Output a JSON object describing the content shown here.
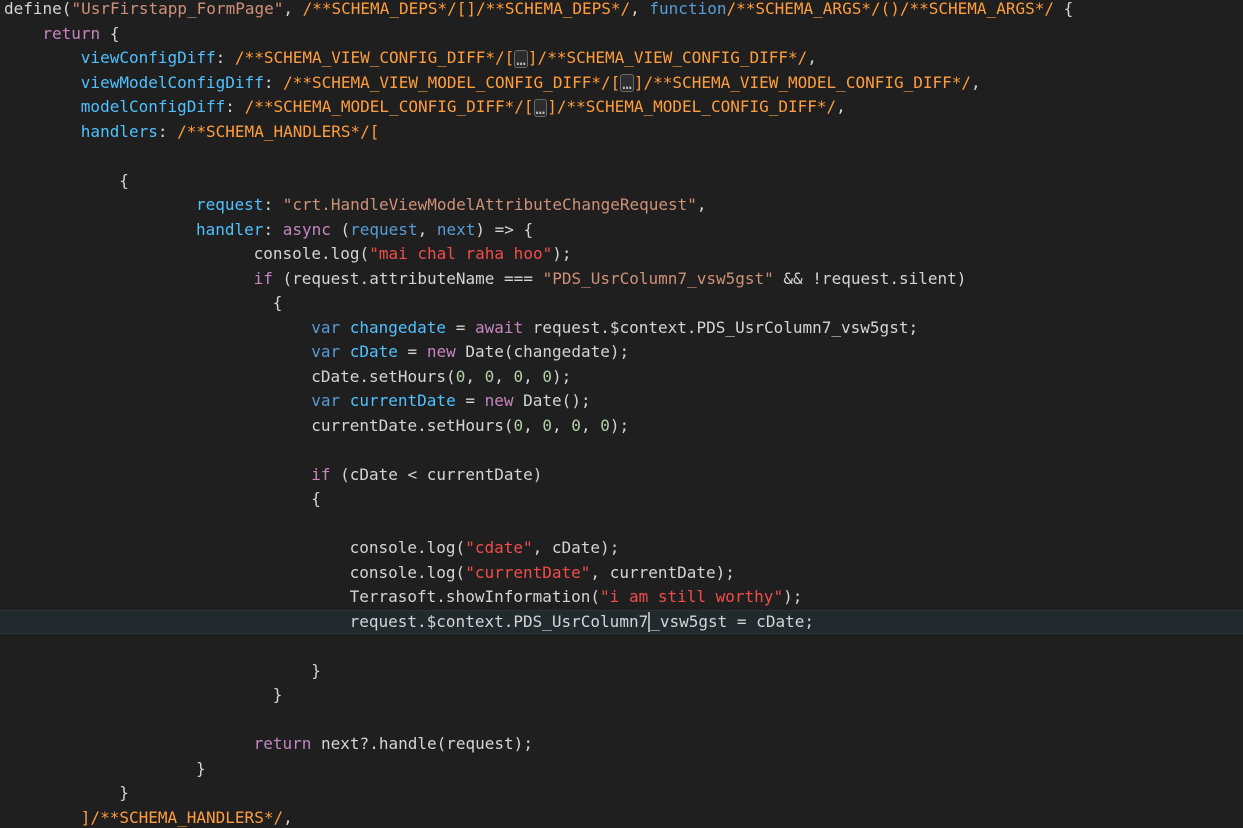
{
  "editor": {
    "lines": [
      {
        "indent": 0,
        "tokens": [
          {
            "t": "define(",
            "k": "plain"
          },
          {
            "t": "\"UsrFirstapp_FormPage\"",
            "k": "str"
          },
          {
            "t": ", ",
            "k": "plain"
          },
          {
            "t": "/**SCHEMA_DEPS*/[]/**SCHEMA_DEPS*/",
            "k": "cmt"
          },
          {
            "t": ", ",
            "k": "plain"
          },
          {
            "t": "function",
            "k": "st"
          },
          {
            "t": "/**SCHEMA_ARGS*/()/**SCHEMA_ARGS*/",
            "k": "cmt"
          },
          {
            "t": " {",
            "k": "plain"
          }
        ]
      },
      {
        "indent": 4,
        "tokens": [
          {
            "t": "return",
            "k": "kw"
          },
          {
            "t": " {",
            "k": "plain"
          }
        ]
      },
      {
        "indent": 8,
        "tokens": [
          {
            "t": "viewConfigDiff",
            "k": "prop"
          },
          {
            "t": ": ",
            "k": "plain"
          },
          {
            "t": "/**SCHEMA_VIEW_CONFIG_DIFF*/[",
            "k": "cmt"
          },
          {
            "t": "…",
            "k": "fold"
          },
          {
            "t": "]/**SCHEMA_VIEW_CONFIG_DIFF*/",
            "k": "cmt"
          },
          {
            "t": ",",
            "k": "plain"
          }
        ]
      },
      {
        "indent": 8,
        "tokens": [
          {
            "t": "viewModelConfigDiff",
            "k": "prop"
          },
          {
            "t": ": ",
            "k": "plain"
          },
          {
            "t": "/**SCHEMA_VIEW_MODEL_CONFIG_DIFF*/[",
            "k": "cmt"
          },
          {
            "t": "…",
            "k": "fold"
          },
          {
            "t": "]/**SCHEMA_VIEW_MODEL_CONFIG_DIFF*/",
            "k": "cmt"
          },
          {
            "t": ",",
            "k": "plain"
          }
        ]
      },
      {
        "indent": 8,
        "tokens": [
          {
            "t": "modelConfigDiff",
            "k": "prop"
          },
          {
            "t": ": ",
            "k": "plain"
          },
          {
            "t": "/**SCHEMA_MODEL_CONFIG_DIFF*/[",
            "k": "cmt"
          },
          {
            "t": "…",
            "k": "fold"
          },
          {
            "t": "]/**SCHEMA_MODEL_CONFIG_DIFF*/",
            "k": "cmt"
          },
          {
            "t": ",",
            "k": "plain"
          }
        ]
      },
      {
        "indent": 8,
        "tokens": [
          {
            "t": "handlers",
            "k": "prop"
          },
          {
            "t": ": ",
            "k": "plain"
          },
          {
            "t": "/**SCHEMA_HANDLERS*/[",
            "k": "cmt"
          }
        ]
      },
      {
        "indent": 0,
        "tokens": []
      },
      {
        "indent": 12,
        "tokens": [
          {
            "t": "{",
            "k": "plain"
          }
        ]
      },
      {
        "indent": 20,
        "tokens": [
          {
            "t": "request",
            "k": "prop"
          },
          {
            "t": ": ",
            "k": "plain"
          },
          {
            "t": "\"crt.HandleViewModelAttributeChangeRequest\"",
            "k": "str"
          },
          {
            "t": ",",
            "k": "plain"
          }
        ]
      },
      {
        "indent": 20,
        "tokens": [
          {
            "t": "handler",
            "k": "prop"
          },
          {
            "t": ": ",
            "k": "plain"
          },
          {
            "t": "async",
            "k": "kw"
          },
          {
            "t": " (",
            "k": "plain"
          },
          {
            "t": "request",
            "k": "st"
          },
          {
            "t": ", ",
            "k": "plain"
          },
          {
            "t": "next",
            "k": "st"
          },
          {
            "t": ") => {",
            "k": "plain"
          }
        ]
      },
      {
        "indent": 26,
        "tokens": [
          {
            "t": "console.log(",
            "k": "plain"
          },
          {
            "t": "\"mai chal raha hoo\"",
            "k": "strr"
          },
          {
            "t": ");",
            "k": "plain"
          }
        ]
      },
      {
        "indent": 26,
        "tokens": [
          {
            "t": "if",
            "k": "kw"
          },
          {
            "t": " (request.attributeName === ",
            "k": "plain"
          },
          {
            "t": "\"PDS_UsrColumn7_vsw5gst\"",
            "k": "str"
          },
          {
            "t": " && !request.silent)",
            "k": "plain"
          }
        ]
      },
      {
        "indent": 28,
        "tokens": [
          {
            "t": "{",
            "k": "plain"
          }
        ]
      },
      {
        "indent": 32,
        "tokens": [
          {
            "t": "var",
            "k": "st"
          },
          {
            "t": " ",
            "k": "plain"
          },
          {
            "t": "changedate",
            "k": "prop"
          },
          {
            "t": " = ",
            "k": "plain"
          },
          {
            "t": "await",
            "k": "kw"
          },
          {
            "t": " request.$context.PDS_UsrColumn7_vsw5gst;",
            "k": "plain"
          }
        ]
      },
      {
        "indent": 32,
        "tokens": [
          {
            "t": "var",
            "k": "st"
          },
          {
            "t": " ",
            "k": "plain"
          },
          {
            "t": "cDate",
            "k": "prop"
          },
          {
            "t": " = ",
            "k": "plain"
          },
          {
            "t": "new",
            "k": "kw"
          },
          {
            "t": " Date(changedate);",
            "k": "plain"
          }
        ]
      },
      {
        "indent": 32,
        "tokens": [
          {
            "t": "cDate.setHours(",
            "k": "plain"
          },
          {
            "t": "0",
            "k": "num"
          },
          {
            "t": ", ",
            "k": "plain"
          },
          {
            "t": "0",
            "k": "num"
          },
          {
            "t": ", ",
            "k": "plain"
          },
          {
            "t": "0",
            "k": "num"
          },
          {
            "t": ", ",
            "k": "plain"
          },
          {
            "t": "0",
            "k": "num"
          },
          {
            "t": ");",
            "k": "plain"
          }
        ]
      },
      {
        "indent": 32,
        "tokens": [
          {
            "t": "var",
            "k": "st"
          },
          {
            "t": " ",
            "k": "plain"
          },
          {
            "t": "currentDate",
            "k": "prop"
          },
          {
            "t": " = ",
            "k": "plain"
          },
          {
            "t": "new",
            "k": "kw"
          },
          {
            "t": " Date();",
            "k": "plain"
          }
        ]
      },
      {
        "indent": 32,
        "tokens": [
          {
            "t": "currentDate.setHours(",
            "k": "plain"
          },
          {
            "t": "0",
            "k": "num"
          },
          {
            "t": ", ",
            "k": "plain"
          },
          {
            "t": "0",
            "k": "num"
          },
          {
            "t": ", ",
            "k": "plain"
          },
          {
            "t": "0",
            "k": "num"
          },
          {
            "t": ", ",
            "k": "plain"
          },
          {
            "t": "0",
            "k": "num"
          },
          {
            "t": ");",
            "k": "plain"
          }
        ]
      },
      {
        "indent": 0,
        "tokens": []
      },
      {
        "indent": 32,
        "tokens": [
          {
            "t": "if",
            "k": "kw"
          },
          {
            "t": " (cDate < currentDate)",
            "k": "plain"
          }
        ]
      },
      {
        "indent": 32,
        "tokens": [
          {
            "t": "{",
            "k": "plain"
          }
        ]
      },
      {
        "indent": 0,
        "tokens": []
      },
      {
        "indent": 36,
        "tokens": [
          {
            "t": "console.log(",
            "k": "plain"
          },
          {
            "t": "\"cdate\"",
            "k": "strr"
          },
          {
            "t": ", cDate);",
            "k": "plain"
          }
        ]
      },
      {
        "indent": 36,
        "tokens": [
          {
            "t": "console.log(",
            "k": "plain"
          },
          {
            "t": "\"currentDate\"",
            "k": "strr"
          },
          {
            "t": ", currentDate);",
            "k": "plain"
          }
        ]
      },
      {
        "indent": 36,
        "tokens": [
          {
            "t": "Terrasoft.showInformation(",
            "k": "plain"
          },
          {
            "t": "\"i am still worthy\"",
            "k": "strr"
          },
          {
            "t": ");",
            "k": "plain"
          }
        ]
      },
      {
        "indent": 36,
        "current": true,
        "tokens": [
          {
            "t": "request.$context.PDS_UsrColumn7",
            "k": "plain"
          },
          {
            "t": "",
            "k": "cursor"
          },
          {
            "t": "_vsw5gst = cDate;",
            "k": "plain"
          }
        ]
      },
      {
        "indent": 0,
        "tokens": []
      },
      {
        "indent": 32,
        "tokens": [
          {
            "t": "}",
            "k": "plain"
          }
        ]
      },
      {
        "indent": 28,
        "tokens": [
          {
            "t": "}",
            "k": "plain"
          }
        ]
      },
      {
        "indent": 0,
        "tokens": []
      },
      {
        "indent": 26,
        "tokens": [
          {
            "t": "return",
            "k": "kw"
          },
          {
            "t": " next?.handle(request);",
            "k": "plain"
          }
        ]
      },
      {
        "indent": 20,
        "tokens": [
          {
            "t": "}",
            "k": "plain"
          }
        ]
      },
      {
        "indent": 12,
        "tokens": [
          {
            "t": "}",
            "k": "plain"
          }
        ]
      },
      {
        "indent": 8,
        "tokens": [
          {
            "t": "]/**SCHEMA_HANDLERS*/",
            "k": "cmt"
          },
          {
            "t": ",",
            "k": "plain"
          }
        ]
      }
    ]
  }
}
